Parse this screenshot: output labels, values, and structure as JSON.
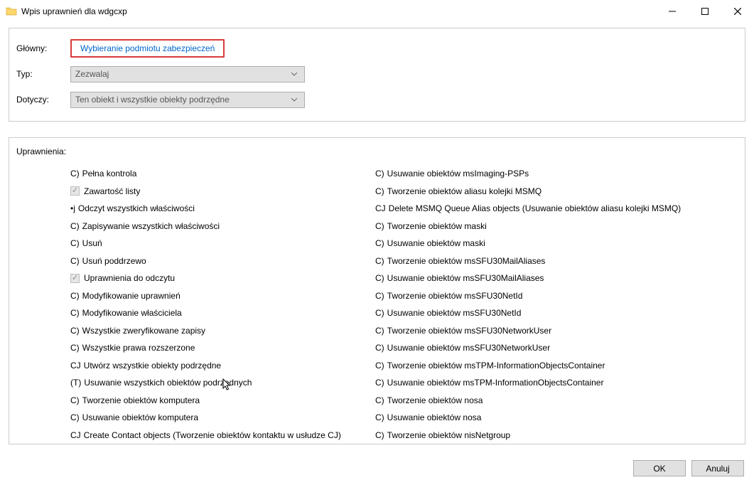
{
  "window": {
    "title": "Wpis uprawnień dla wdgcxp"
  },
  "form": {
    "principal_label": "Główny:",
    "principal_link": "Wybieranie podmiotu zabezpieczeń",
    "type_label": "Typ:",
    "type_value": "Zezwalaj",
    "applies_label": "Dotyczy:",
    "applies_value": "Ten obiekt i wszystkie obiekty podrzędne"
  },
  "permissions": {
    "header": "Uprawnienia:",
    "left": [
      {
        "prefix": "C)",
        "label": "Pełna kontrola",
        "checked": false,
        "disabled": false
      },
      {
        "prefix": "",
        "label": "Zawartość listy",
        "checked": true,
        "disabled": true,
        "checkbox": true
      },
      {
        "prefix": "•j",
        "label": "Odczyt wszystkich właściwości",
        "checked": false,
        "disabled": false
      },
      {
        "prefix": "C)",
        "label": "Zapisywanie wszystkich właściwości",
        "checked": false,
        "disabled": false
      },
      {
        "prefix": "C)",
        "label": "Usuń",
        "checked": false,
        "disabled": false
      },
      {
        "prefix": "C)",
        "label": "Usuń poddrzewo",
        "checked": false,
        "disabled": false
      },
      {
        "prefix": "",
        "label": "Uprawnienia do odczytu",
        "checked": true,
        "disabled": true,
        "checkbox": true
      },
      {
        "prefix": "C)",
        "label": "Modyfikowanie uprawnień",
        "checked": false,
        "disabled": false
      },
      {
        "prefix": "C)",
        "label": "Modyfikowanie właściciela",
        "checked": false,
        "disabled": false
      },
      {
        "prefix": "C)",
        "label": "Wszystkie zweryfikowane zapisy",
        "checked": false,
        "disabled": false
      },
      {
        "prefix": "C)",
        "label": "Wszystkie prawa rozszerzone",
        "checked": false,
        "disabled": false
      },
      {
        "prefix": "CJ",
        "label": "Utwórz wszystkie obiekty podrzędne",
        "checked": false,
        "disabled": false
      },
      {
        "prefix": "(T)",
        "label": "Usuwanie wszystkich obiektów podrzędnych",
        "checked": false,
        "disabled": false
      },
      {
        "prefix": "C)",
        "label": "Tworzenie obiektów komputera",
        "checked": false,
        "disabled": false
      },
      {
        "prefix": "C)",
        "label": "Usuwanie obiektów komputera",
        "checked": false,
        "disabled": false
      },
      {
        "prefix": "CJ",
        "label": "Create Contact objects (Tworzenie obiektów kontaktu w usłudze CJ)",
        "checked": false,
        "disabled": false
      }
    ],
    "right": [
      {
        "prefix": "C)",
        "label": "Usuwanie obiektów msImaging-PSPs"
      },
      {
        "prefix": "C)",
        "label": "Tworzenie obiektów aliasu kolejki MSMQ"
      },
      {
        "prefix": "CJ",
        "label": "Delete MSMQ Queue Alias objects (Usuwanie obiektów aliasu kolejki MSMQ)"
      },
      {
        "prefix": "C)",
        "label": "Tworzenie obiektów maski"
      },
      {
        "prefix": "C)",
        "label": "Usuwanie obiektów maski"
      },
      {
        "prefix": "C)",
        "label": "Tworzenie obiektów msSFU30MailAliases"
      },
      {
        "prefix": "C)",
        "label": "Usuwanie obiektów msSFU30MailAliases"
      },
      {
        "prefix": "C)",
        "label": "Tworzenie obiektów msSFU30NetId"
      },
      {
        "prefix": "C)",
        "label": "Usuwanie obiektów msSFU30NetId"
      },
      {
        "prefix": "C)",
        "label": "Tworzenie obiektów msSFU30NetworkUser"
      },
      {
        "prefix": "C)",
        "label": "Usuwanie obiektów msSFU30NetworkUser"
      },
      {
        "prefix": "C)",
        "label": "Tworzenie obiektów msTPM-InformationObjectsContainer"
      },
      {
        "prefix": "C)",
        "label": "Usuwanie obiektów msTPM-InformationObjectsContainer"
      },
      {
        "prefix": "C)",
        "label": "Tworzenie obiektów nosa"
      },
      {
        "prefix": "C)",
        "label": "Usuwanie obiektów nosa"
      },
      {
        "prefix": "C)",
        "label": "Tworzenie obiektów nisNetgroup"
      }
    ]
  },
  "buttons": {
    "ok": "OK",
    "cancel": "Anuluj"
  }
}
